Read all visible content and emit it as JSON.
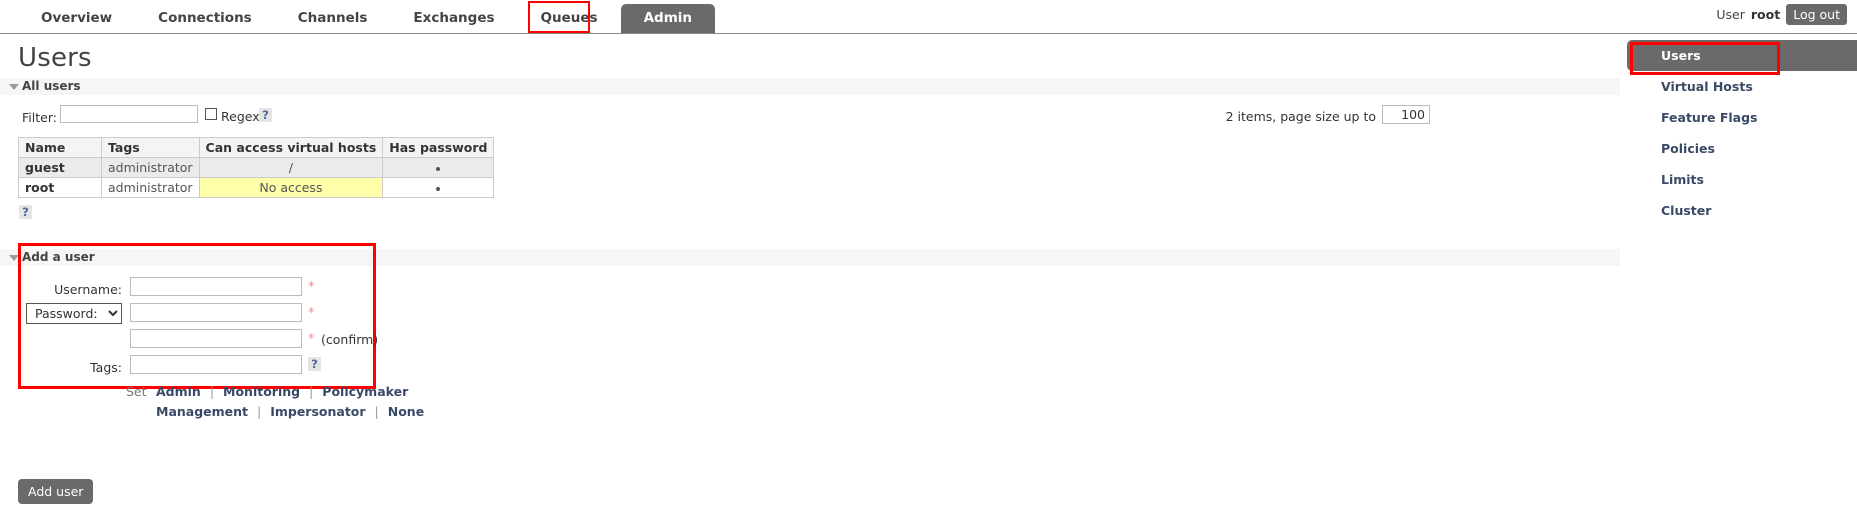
{
  "nav": {
    "tabs": [
      {
        "label": "Overview",
        "active": false
      },
      {
        "label": "Connections",
        "active": false
      },
      {
        "label": "Channels",
        "active": false
      },
      {
        "label": "Exchanges",
        "active": false
      },
      {
        "label": "Queues",
        "active": false
      },
      {
        "label": "Admin",
        "active": true
      }
    ],
    "user_prefix": "User",
    "user_name": "root",
    "logout_label": "Log out"
  },
  "page": {
    "title": "Users"
  },
  "all_users": {
    "section_label": "All users",
    "filter_label": "Filter:",
    "filter_value": "",
    "filter_placeholder": "",
    "regex_label": "Regex",
    "regex_checked": false,
    "regex_help": "?",
    "paging_text": "2 items, page size up to",
    "page_size": "100",
    "table_help": "?",
    "columns": [
      "Name",
      "Tags",
      "Can access virtual hosts",
      "Has password"
    ],
    "rows": [
      {
        "name": "guest",
        "tags": "administrator",
        "vhosts": "/",
        "vhosts_none": false,
        "has_password": "•"
      },
      {
        "name": "root",
        "tags": "administrator",
        "vhosts": "No access",
        "vhosts_none": true,
        "has_password": "•"
      }
    ]
  },
  "add_user": {
    "section_label": "Add a user",
    "username_label": "Username:",
    "username_value": "",
    "password_select_label": "Password:",
    "password_value": "",
    "password_confirm_value": "",
    "confirm_note": "(confirm)",
    "required_marker": "*",
    "tags_label": "Tags:",
    "tags_value": "",
    "tags_help": "?",
    "set_label": "Set",
    "presets_row1": [
      "Admin",
      "Monitoring",
      "Policymaker"
    ],
    "presets_row2": [
      "Management",
      "Impersonator",
      "None"
    ],
    "separator": "|",
    "submit_label": "Add user"
  },
  "sidebar": {
    "items": [
      {
        "label": "Users",
        "active": true
      },
      {
        "label": "Virtual Hosts",
        "active": false
      },
      {
        "label": "Feature Flags",
        "active": false
      },
      {
        "label": "Policies",
        "active": false
      },
      {
        "label": "Limits",
        "active": false
      },
      {
        "label": "Cluster",
        "active": false
      }
    ]
  },
  "colors": {
    "accent_dark": "#6a6a6a",
    "annotation": "#ff0000",
    "highlight_yellow": "#ffffaa",
    "link": "#3a4a66"
  }
}
